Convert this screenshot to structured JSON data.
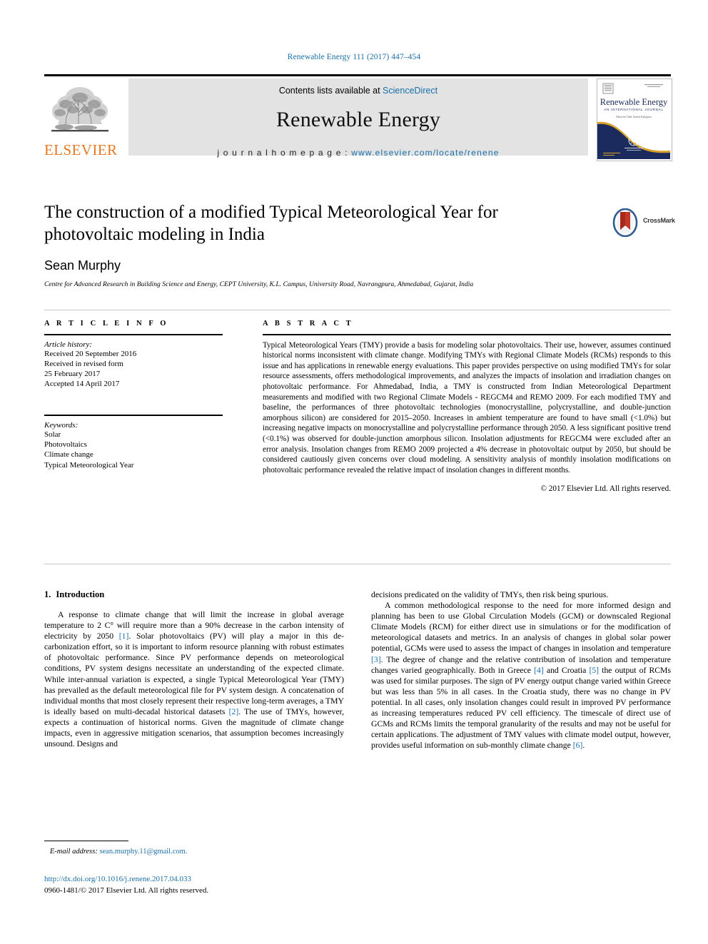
{
  "running_head": "Renewable Energy 111 (2017) 447–454",
  "masthead": {
    "contents_prefix": "Contents lists available at ",
    "sciencedirect": "ScienceDirect",
    "journal_title": "Renewable Energy",
    "homepage_prefix": "j o u r n a l   h o m e p a g e :   ",
    "homepage_url": "www.elsevier.com/locate/renene",
    "publisher_word": "ELSEVIER",
    "cover": {
      "title": "Renewable Energy",
      "subtitle": "AN INTERNATIONAL JOURNAL",
      "tagline": "Editor-in-Chief: Soteris Kalogirou"
    },
    "accent_color": "#1a6fa8",
    "brand_color": "#E87722",
    "band_color": "#e3e3e3"
  },
  "title_block": {
    "title": "The construction of a modified Typical Meteorological Year for photovoltaic modeling in India",
    "author": "Sean Murphy",
    "affiliation": "Centre for Advanced Research in Building Science and Energy, CEPT University, K.L. Campus, University Road, Navrangpura, Ahmedabad, Gujarat, India",
    "crossmark_label": "CrossMark"
  },
  "article_info": {
    "heading": "A R T I C L E   I N F O",
    "history_label": "Article history:",
    "history": [
      "Received 20 September 2016",
      "Received in revised form",
      "25 February 2017",
      "Accepted 14 April 2017"
    ],
    "keywords_label": "Keywords:",
    "keywords": [
      "Solar",
      "Photovoltaics",
      "Climate change",
      "Typical Meteorological Year"
    ]
  },
  "abstract": {
    "heading": "A B S T R A C T",
    "text": "Typical Meteorological Years (TMY) provide a basis for modeling solar photovoltaics. Their use, however, assumes continued historical norms inconsistent with climate change. Modifying TMYs with Regional Climate Models (RCMs) responds to this issue and has applications in renewable energy evaluations. This paper provides perspective on using modified TMYs for solar resource assessments, offers methodological improvements, and analyzes the impacts of insolation and irradiation changes on photovoltaic performance. For Ahmedabad, India, a TMY is constructed from Indian Meteorological Department measurements and modified with two Regional Climate Models - REGCM4 and REMO 2009. For each modified TMY and baseline, the performances of three photovoltaic technologies (monocrystalline, polycrystalline, and double-junction amorphous silicon) are considered for 2015–2050. Increases in ambient temperature are found to have small (<1.0%) but increasing negative impacts on monocrystalline and polycrystalline performance through 2050. A less significant positive trend (<0.1%) was observed for double-junction amorphous silicon. Insolation adjustments for REGCM4 were excluded after an error analysis. Insolation changes from REMO 2009 projected a 4% decrease in photovoltaic output by 2050, but should be considered cautiously given concerns over cloud modeling. A sensitivity analysis of monthly insolation modifications on photovoltaic performance revealed the relative impact of insolation changes in different months.",
    "copyright": "© 2017 Elsevier Ltd. All rights reserved."
  },
  "body": {
    "section_number": "1.",
    "section_title": "Introduction",
    "left_paragraphs": [
      {
        "parts": [
          {
            "t": "A response to climate change that will limit the increase in global average temperature to 2 C° will require more than a 90% decrease in the carbon intensity of electricity by 2050 "
          },
          {
            "t": "[1]",
            "ref": true
          },
          {
            "t": ". Solar photovoltaics (PV) will play a major in this de-carbonization effort, so it is important to inform resource planning with robust estimates of photovoltaic performance. Since PV performance depends on meteorological conditions, PV system designs necessitate an understanding of the expected climate. While inter-annual variation is expected, a single Typical Meteorological Year (TMY) has prevailed as the default meteorological file for PV system design. A concatenation of individual months that most closely represent their respective long-term averages, a TMY is ideally based on multi-decadal historical datasets "
          },
          {
            "t": "[2]",
            "ref": true
          },
          {
            "t": ". The use of TMYs, however, expects a continuation of historical norms. Given the magnitude of climate change impacts, even in aggressive mitigation scenarios, that assumption becomes increasingly unsound. Designs and"
          }
        ]
      }
    ],
    "right_paragraphs": [
      {
        "noindent": true,
        "parts": [
          {
            "t": "decisions predicated on the validity of TMYs, then risk being spurious."
          }
        ]
      },
      {
        "parts": [
          {
            "t": "A common methodological response to the need for more informed design and planning has been to use Global Circulation Models (GCM) or downscaled Regional Climate Models (RCM) for either direct use in simulations or for the modification of meteorological datasets and metrics. In an analysis of changes in global solar power potential, GCMs were used to assess the impact of changes in insolation and temperature "
          },
          {
            "t": "[3]",
            "ref": true
          },
          {
            "t": ". The degree of change and the relative contribution of insolation and temperature changes varied geographically. Both in Greece "
          },
          {
            "t": "[4]",
            "ref": true
          },
          {
            "t": " and Croatia "
          },
          {
            "t": "[5]",
            "ref": true
          },
          {
            "t": " the output of RCMs was used for similar purposes. The sign of PV energy output change varied within Greece but was less than 5% in all cases. In the Croatia study, there was no change in PV potential. In all cases, only insolation changes could result in improved PV performance as increasing temperatures reduced PV cell efficiency. The timescale of direct use of GCMs and RCMs limits the temporal granularity of the results and may not be useful for certain applications. The adjustment of TMY values with climate model output, however, provides useful information on sub-monthly climate change "
          },
          {
            "t": "[6]",
            "ref": true
          },
          {
            "t": "."
          }
        ]
      }
    ]
  },
  "footnote": {
    "email_label": "E-mail address:",
    "email": "sean.murphy.11@gmail.com."
  },
  "publication_footer": {
    "doi": "http://dx.doi.org/10.1016/j.renene.2017.04.033",
    "issn_line": "0960-1481/© 2017 Elsevier Ltd. All rights reserved."
  }
}
